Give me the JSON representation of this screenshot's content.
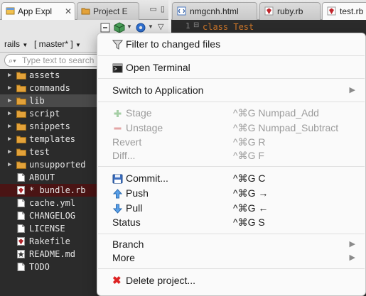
{
  "left_panel": {
    "tabs": [
      {
        "label": "App Expl",
        "close": "✕"
      },
      {
        "label": "Project E"
      }
    ],
    "minmax": "▭ ▯",
    "scope": {
      "project": "rails",
      "branch": "[ master* ]"
    },
    "search": {
      "placeholder": "Type text to search in"
    },
    "tree": [
      {
        "name": "assets",
        "type": "folder",
        "expandable": true
      },
      {
        "name": "commands",
        "type": "folder",
        "expandable": true
      },
      {
        "name": "lib",
        "type": "folder",
        "expandable": true
      },
      {
        "name": "script",
        "type": "folder",
        "expandable": true
      },
      {
        "name": "snippets",
        "type": "folder",
        "expandable": true
      },
      {
        "name": "templates",
        "type": "folder",
        "expandable": true
      },
      {
        "name": "test",
        "type": "folder",
        "expandable": true
      },
      {
        "name": "unsupported",
        "type": "folder",
        "expandable": true
      },
      {
        "name": "ABOUT",
        "type": "file",
        "expandable": false
      },
      {
        "name": "* bundle.rb",
        "type": "ruby",
        "expandable": false
      },
      {
        "name": "cache.yml",
        "type": "file",
        "expandable": false
      },
      {
        "name": "CHANGELOG",
        "type": "file",
        "expandable": false
      },
      {
        "name": "LICENSE",
        "type": "file",
        "expandable": false
      },
      {
        "name": "Rakefile",
        "type": "ruby",
        "expandable": false
      },
      {
        "name": "README.md",
        "type": "star",
        "expandable": false
      },
      {
        "name": "TODO",
        "type": "file",
        "expandable": false
      }
    ]
  },
  "editor": {
    "tabs": [
      {
        "label": "nmgcnh.html"
      },
      {
        "label": "ruby.rb"
      },
      {
        "label": "test.rb"
      }
    ],
    "line_number": "1",
    "code_line_1": "class Test"
  },
  "context_menu": {
    "filter": "Filter to changed files",
    "open_terminal": "Open Terminal",
    "switch_app": "Switch to Application",
    "stage": {
      "label": "Stage",
      "shortcut": "^⌘G Numpad_Add"
    },
    "unstage": {
      "label": "Unstage",
      "shortcut": "^⌘G Numpad_Subtract"
    },
    "revert": {
      "label": "Revert",
      "shortcut": "^⌘G R"
    },
    "diff": {
      "label": "Diff...",
      "shortcut": "^⌘G F"
    },
    "commit": {
      "label": "Commit...",
      "shortcut": "^⌘G C"
    },
    "push": {
      "label": "Push",
      "shortcut": "^⌘G →"
    },
    "pull": {
      "label": "Pull",
      "shortcut": "^⌘G ←"
    },
    "status": {
      "label": "Status",
      "shortcut": "^⌘G S"
    },
    "branch": "Branch",
    "more": "More",
    "delete": "Delete project...",
    "submenu_arrow": "▶"
  },
  "colors": {
    "folder": "#e3a23a",
    "ruby": "#b0242a",
    "modified_row": "#4a1414",
    "selected_row": "#4a4a4a",
    "keyword": "#d0782a"
  }
}
